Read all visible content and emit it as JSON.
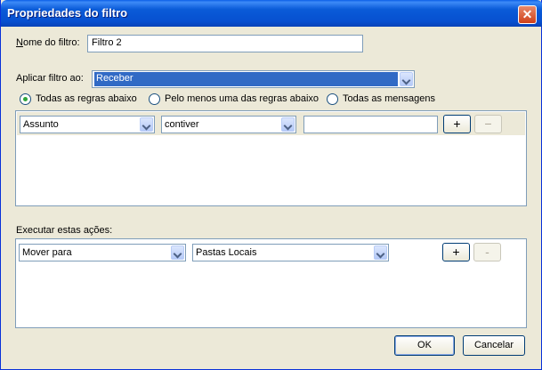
{
  "window": {
    "title": "Propriedades do filtro",
    "close_glyph": "✕"
  },
  "filter_name": {
    "label": "Nome do filtro:",
    "value": "Filtro 2"
  },
  "apply_filter": {
    "label": "Aplicar filtro ao:",
    "selected": "Receber"
  },
  "match_mode": {
    "options": [
      {
        "label": "Todas as regras abaixo",
        "selected": true
      },
      {
        "label": "Pelo menos uma das regras abaixo",
        "selected": false
      },
      {
        "label": "Todas as mensagens",
        "selected": false
      }
    ]
  },
  "rule": {
    "field": "Assunto",
    "operator": "contiver",
    "value": "",
    "add_label": "+",
    "remove_label": "−"
  },
  "actions": {
    "label": "Executar estas ações:",
    "action": "Mover para",
    "target": "Pastas Locais",
    "add_label": "+",
    "remove_label": "-"
  },
  "buttons": {
    "ok": "OK",
    "cancel": "Cancelar"
  },
  "colors": {
    "titlebar": "#0a5bd8",
    "dialog_bg": "#ece9d8",
    "selection": "#316ac5",
    "radio_dot": "#2fa53b"
  }
}
